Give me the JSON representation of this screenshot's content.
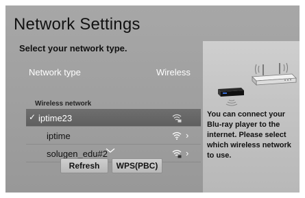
{
  "header": {
    "title": "Network Settings",
    "subtitle": "Select your network type."
  },
  "network_type": {
    "label": "Network type",
    "value": "Wireless"
  },
  "wireless_list": {
    "label": "Wireless network",
    "items": [
      {
        "name": "iptime23",
        "selected": true,
        "check": "✓",
        "signal": "wifi-locked-icon",
        "chevron": ""
      },
      {
        "name": "iptime",
        "selected": false,
        "check": "",
        "signal": "wifi-icon",
        "chevron": "›"
      },
      {
        "name": "solugen_edu#2",
        "selected": false,
        "check": "",
        "signal": "wifi-locked-icon",
        "chevron": "›"
      }
    ]
  },
  "buttons": {
    "refresh": "Refresh",
    "wps": "WPS(PBC)"
  },
  "help": {
    "text": "You can connect your Blu-ray player to the internet. Please select which wireless network to use."
  },
  "colors": {
    "panel": "#a3a3a3",
    "selected_row": "#666666",
    "side_panel": "#c8c8c8"
  }
}
